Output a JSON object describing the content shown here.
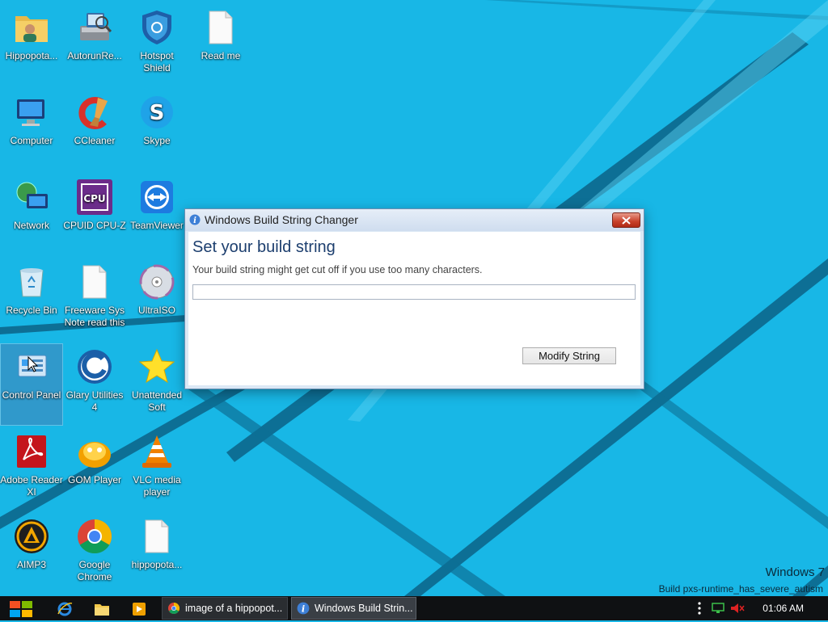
{
  "desktop": {
    "icons": [
      {
        "label": "Hippopota...",
        "icon": "folder-person-icon"
      },
      {
        "label": "AutorunRe...",
        "icon": "system-tool-icon"
      },
      {
        "label": "Hotspot Shield",
        "icon": "shield-icon"
      },
      {
        "label": "Read me",
        "icon": "document-icon"
      },
      {
        "label": "Computer",
        "icon": "computer-icon"
      },
      {
        "label": "CCleaner",
        "icon": "ccleaner-icon"
      },
      {
        "label": "Skype",
        "icon": "skype-icon"
      },
      {
        "label": "Network",
        "icon": "network-icon"
      },
      {
        "label": "CPUID CPU-Z",
        "icon": "cpuz-icon"
      },
      {
        "label": "TeamViewer",
        "icon": "teamviewer-icon"
      },
      {
        "label": "Recycle Bin",
        "icon": "recycle-bin-icon"
      },
      {
        "label": "Freeware Sys Note read this",
        "icon": "document-icon"
      },
      {
        "label": "UltraISO",
        "icon": "disc-icon"
      },
      {
        "label": "Control Panel",
        "icon": "control-panel-icon"
      },
      {
        "label": "Glary Utilities 4",
        "icon": "glary-icon"
      },
      {
        "label": "Unattended Soft",
        "icon": "star-icon"
      },
      {
        "label": "Adobe Reader XI",
        "icon": "adobe-reader-icon"
      },
      {
        "label": "GOM Player",
        "icon": "gom-player-icon"
      },
      {
        "label": "VLC media player",
        "icon": "vlc-icon"
      },
      {
        "label": "AIMP3",
        "icon": "aimp-icon"
      },
      {
        "label": "Google Chrome",
        "icon": "chrome-icon"
      },
      {
        "label": "hippopota...",
        "icon": "document-icon"
      }
    ]
  },
  "dialog": {
    "title": "Windows Build String Changer",
    "heading": "Set your build string",
    "subtext": "Your build string might get cut off if you use too many characters.",
    "input_value": "",
    "button_label": "Modify String"
  },
  "watermark": {
    "title": "Windows 7",
    "build": "Build pxs-runtime_has_severe_autism"
  },
  "taskbar": {
    "tasks": [
      {
        "label": "image of a hippopot...",
        "icon": "chrome-icon"
      },
      {
        "label": "Windows Build Strin...",
        "icon": "info-icon"
      }
    ],
    "clock": "01:06 AM"
  },
  "colors": {
    "wallpaper": "#18b7e6",
    "taskbar": "#0f1113",
    "dialog_heading": "#1c3e6e"
  }
}
